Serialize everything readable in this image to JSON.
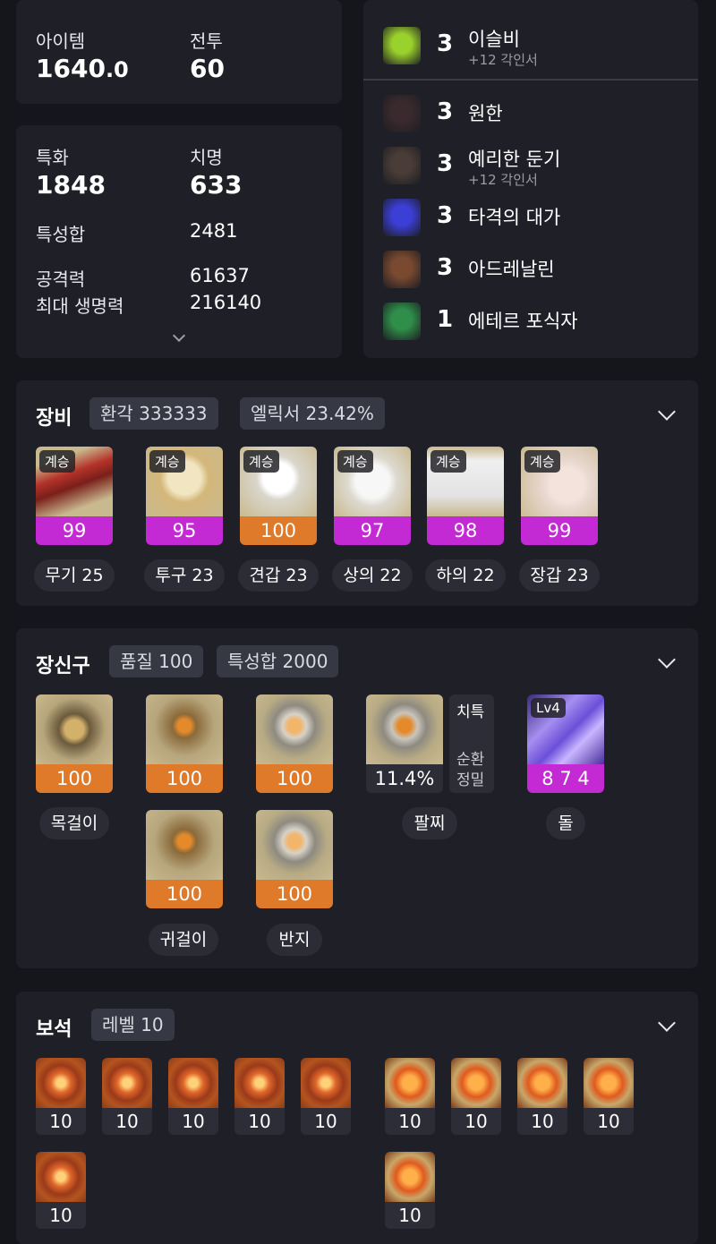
{
  "stats_top": {
    "item_label": "아이템",
    "item_value_main": "1640",
    "item_value_dec": ".0",
    "combat_label": "전투",
    "combat_value": "60"
  },
  "stats": {
    "spec_label": "특화",
    "spec_value": "1848",
    "crit_label": "치명",
    "crit_value": "633",
    "total_label": "특성합",
    "total_value": "2481",
    "atk_label": "공격력",
    "atk_value": "61637",
    "hp_label": "최대 생명력",
    "hp_value": "216140"
  },
  "engravings": [
    {
      "level": "3",
      "name": "이슬비",
      "sub": "+12 각인서",
      "icon": "rain-umbrella-icon",
      "color": "#9bd12c"
    },
    {
      "level": "3",
      "name": "원한",
      "sub": "",
      "icon": "demon-icon",
      "color": "#3a2a2e"
    },
    {
      "level": "3",
      "name": "예리한 둔기",
      "sub": "+12 각인서",
      "icon": "spiked-ball-icon",
      "color": "#4a3d38"
    },
    {
      "level": "3",
      "name": "타격의 대가",
      "sub": "",
      "icon": "lightning-strike-icon",
      "color": "#3b3fd6"
    },
    {
      "level": "3",
      "name": "아드레날린",
      "sub": "",
      "icon": "warrior-icon",
      "color": "#7a4a30"
    },
    {
      "level": "1",
      "name": "에테르 포식자",
      "sub": "",
      "icon": "ether-hand-icon",
      "color": "#2f8f4a"
    }
  ],
  "equipment": {
    "title": "장비",
    "pill1": "환각 333333",
    "pill2": "엘릭서 23.42%",
    "items": [
      {
        "tag": "계승",
        "quality": "99",
        "label": "무기 25",
        "bar": "purple",
        "icon": "pickaxe-weapon-icon"
      },
      {
        "tag": "계승",
        "quality": "95",
        "label": "투구 23",
        "bar": "purple",
        "icon": "helmet-icon"
      },
      {
        "tag": "계승",
        "quality": "100",
        "label": "견갑 23",
        "bar": "orange",
        "icon": "shoulder-icon"
      },
      {
        "tag": "계승",
        "quality": "97",
        "label": "상의 22",
        "bar": "purple",
        "icon": "chest-armor-icon"
      },
      {
        "tag": "계승",
        "quality": "98",
        "label": "하의 22",
        "bar": "purple",
        "icon": "pants-icon"
      },
      {
        "tag": "계승",
        "quality": "99",
        "label": "장갑 23",
        "bar": "purple",
        "icon": "gloves-icon"
      }
    ]
  },
  "accessories": {
    "title": "장신구",
    "pill1": "품질 100",
    "pill2": "특성합 2000",
    "necklace": {
      "quality": "100",
      "label": "목걸이",
      "icon": "necklace-icon"
    },
    "earring1": {
      "quality": "100",
      "icon": "earring-icon"
    },
    "earring2": {
      "quality": "100",
      "label": "귀걸이",
      "icon": "earring-icon"
    },
    "ring1": {
      "quality": "100",
      "icon": "ring-icon"
    },
    "ring2": {
      "quality": "100",
      "label": "반지",
      "icon": "ring-icon"
    },
    "bracelet": {
      "value": "11.4%",
      "label": "팔찌",
      "stat1": "치특",
      "stat2": "순환",
      "stat3": "정밀",
      "icon": "bracelet-icon"
    },
    "stone": {
      "level": "Lv4",
      "value": "8 7 4",
      "label": "돌",
      "icon": "ability-stone-icon"
    }
  },
  "gems": {
    "title": "보석",
    "pill": "레벨 10",
    "left": [
      "10",
      "10",
      "10",
      "10",
      "10",
      "10"
    ],
    "right": [
      "10",
      "10",
      "10",
      "10",
      "10"
    ]
  }
}
